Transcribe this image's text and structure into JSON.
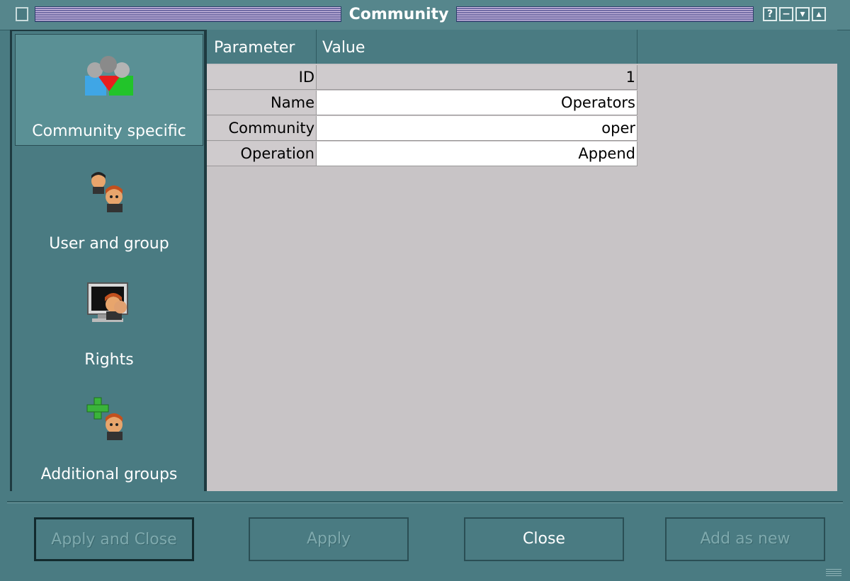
{
  "window": {
    "title": "Community",
    "help_glyph": "?",
    "minimize_glyph": "−",
    "shade_glyph": "▾",
    "maximize_glyph": "▴"
  },
  "sidebar": {
    "items": [
      {
        "label": "Community specific",
        "icon": "community-icon",
        "selected": true
      },
      {
        "label": "User and group",
        "icon": "user-group-icon",
        "selected": false
      },
      {
        "label": "Rights",
        "icon": "rights-monitor-icon",
        "selected": false
      },
      {
        "label": "Additional groups",
        "icon": "add-group-icon",
        "selected": false
      }
    ]
  },
  "table": {
    "headers": {
      "parameter": "Parameter",
      "value": "Value"
    },
    "rows": [
      {
        "parameter": "ID",
        "value": "1",
        "editable": false
      },
      {
        "parameter": "Name",
        "value": "Operators",
        "editable": true
      },
      {
        "parameter": "Community",
        "value": "oper",
        "editable": true
      },
      {
        "parameter": "Operation",
        "value": "Append",
        "editable": true
      }
    ]
  },
  "buttons": {
    "apply_close": {
      "label": "Apply and Close",
      "enabled": false
    },
    "apply": {
      "label": "Apply",
      "enabled": false
    },
    "close": {
      "label": "Close",
      "enabled": true
    },
    "add_new": {
      "label": "Add as new",
      "enabled": false
    }
  },
  "colors": {
    "window_bg": "#4a7b82",
    "table_bg": "#c8c4c6",
    "title_stripe_light": "#d8c6e8",
    "title_stripe_dark": "#6f6aa4"
  }
}
